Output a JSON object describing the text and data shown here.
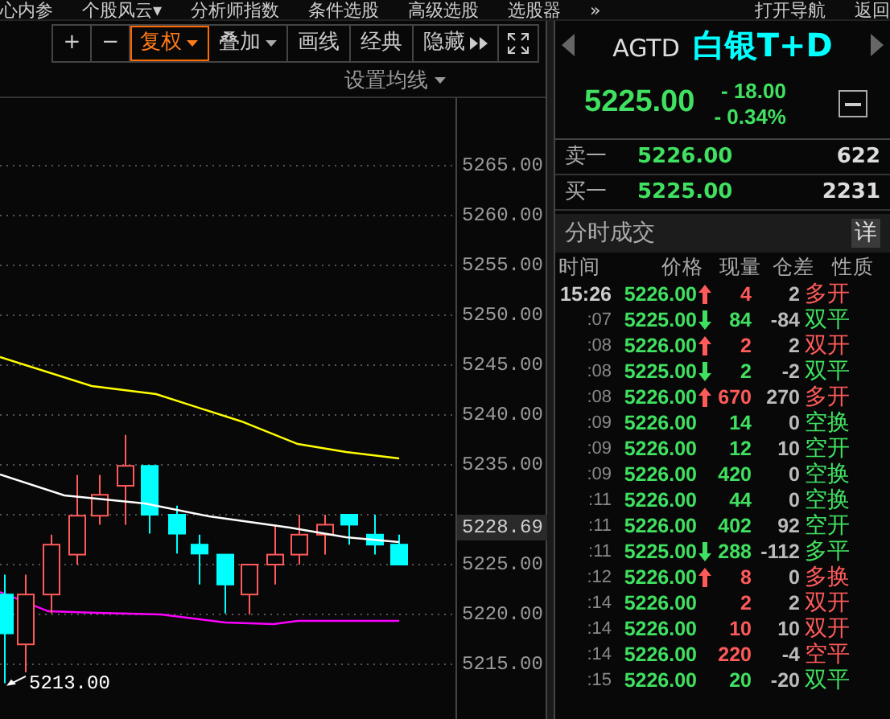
{
  "menu": [
    "心内参",
    "个股风云▾",
    "分析师指数",
    "条件选股",
    "高级选股",
    "选股器",
    "»",
    "打开导航",
    "返回"
  ],
  "toolbar": [
    {
      "label": "+",
      "selected": false
    },
    {
      "label": "−",
      "selected": false
    },
    {
      "label": "复权",
      "selected": true,
      "dropdown": true
    },
    {
      "label": "叠加",
      "selected": false,
      "dropdown": true
    },
    {
      "label": "画线",
      "selected": false
    },
    {
      "label": "经典",
      "selected": false
    },
    {
      "label": "隐藏",
      "selected": false,
      "chevrons": true
    }
  ],
  "chart": {
    "ma_settings": "设置均线",
    "yticks": [
      "5265.00",
      "5260.00",
      "5255.00",
      "5250.00",
      "5245.00",
      "5240.00",
      "5235.00",
      "5225.00",
      "5220.00",
      "5215.00"
    ],
    "current_price": "5228.69",
    "low_label": "5213.00"
  },
  "quote": {
    "code": "AGTD",
    "name": "白银T+D",
    "price": "5225.00",
    "change": "- 18.00",
    "change_pct": "- 0.34%"
  },
  "book": [
    {
      "label": "卖一",
      "price": "5226.00",
      "volume": "622"
    },
    {
      "label": "买一",
      "price": "5225.00",
      "volume": "2231"
    }
  ],
  "ticks_panel": {
    "title": "分时成交",
    "detail_button": "详",
    "columns": [
      "时间",
      "价格",
      "现量",
      "仓差",
      "性质"
    ],
    "rows": [
      {
        "time": "15:26",
        "price": "5226.00",
        "kind": "up",
        "volume": "4",
        "oi": "2",
        "type": "多开",
        "color": "#ff5a5a"
      },
      {
        "time": ":07",
        "price": "5225.00",
        "kind": "down",
        "volume": "84",
        "oi": "-84",
        "type": "双平",
        "color": "#40e060"
      },
      {
        "time": ":08",
        "price": "5226.00",
        "kind": "up",
        "volume": "2",
        "oi": "2",
        "type": "双开",
        "color": "#ff5a5a"
      },
      {
        "time": ":08",
        "price": "5225.00",
        "kind": "down",
        "volume": "2",
        "oi": "-2",
        "type": "双平",
        "color": "#40e060"
      },
      {
        "time": ":08",
        "price": "5226.00",
        "kind": "up",
        "volume": "670",
        "oi": "270",
        "type": "多开",
        "color": "#ff5a5a"
      },
      {
        "time": ":09",
        "price": "5226.00",
        "kind": "flat",
        "volume": "14",
        "oi": "0",
        "type": "空换",
        "color": "#40e060"
      },
      {
        "time": ":09",
        "price": "5226.00",
        "kind": "flat",
        "volume": "12",
        "oi": "10",
        "type": "空开",
        "color": "#40e060"
      },
      {
        "time": ":09",
        "price": "5226.00",
        "kind": "flat",
        "volume": "420",
        "oi": "0",
        "type": "空换",
        "color": "#40e060"
      },
      {
        "time": ":11",
        "price": "5226.00",
        "kind": "flat",
        "volume": "44",
        "oi": "0",
        "type": "空换",
        "color": "#40e060"
      },
      {
        "time": ":11",
        "price": "5226.00",
        "kind": "flat",
        "volume": "402",
        "oi": "92",
        "type": "空开",
        "color": "#40e060"
      },
      {
        "time": ":11",
        "price": "5225.00",
        "kind": "down",
        "volume": "288",
        "oi": "-112",
        "type": "多平",
        "color": "#40e060"
      },
      {
        "time": ":12",
        "price": "5226.00",
        "kind": "up",
        "volume": "8",
        "oi": "0",
        "type": "多换",
        "color": "#ff5a5a"
      },
      {
        "time": ":14",
        "price": "5226.00",
        "kind": "flat",
        "volume": "2",
        "oi": "2",
        "type": "双开",
        "color": "#ff5a5a"
      },
      {
        "time": ":14",
        "price": "5226.00",
        "kind": "flat",
        "volume": "10",
        "oi": "10",
        "type": "双开",
        "color": "#ff5a5a"
      },
      {
        "time": ":14",
        "price": "5226.00",
        "kind": "flat",
        "volume": "220",
        "oi": "-4",
        "type": "空平",
        "color": "#ff5a5a"
      },
      {
        "time": ":15",
        "price": "5226.00",
        "kind": "flat",
        "volume": "20",
        "oi": "-20",
        "type": "双平",
        "color": "#40e060"
      }
    ]
  }
}
